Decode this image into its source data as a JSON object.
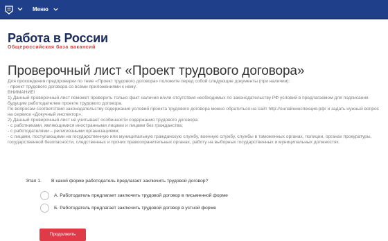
{
  "header": {
    "menu_label": "Меню",
    "logo_icon": "rabota-emblem-icon",
    "chevron_icon": "chevron-down-icon",
    "background": "#1f3f8a"
  },
  "brand": {
    "name": "Работа в России",
    "subtitle": "Общероссийская база вакансий",
    "name_color": "#1a2b5f",
    "subtitle_color": "#d83a3a"
  },
  "page": {
    "title": "Проверочный лист «Проект трудового договора»"
  },
  "info": {
    "lines": [
      "Для прохождения предпроверки по теме «Проект трудового договора» положите перед собой следующие документы (при наличии):",
      "- проект трудового договора со всеми приложениями к нему.",
      "ВНИМАНИЕ!",
      "1) Данный проверочный лист поможет проверить только факт наличия и/или отсутствия необходимых по законодательству РФ условий в предлагаемом для подписания будущим работодателем проекте трудового договора.",
      "По вопросам соответствия законодательству содержания условий проекта трудового договора можно обратиться на сайт http://онлайнинспекция.рф/ и задать нужный вопрос на сервисе «Докучный инспектор».",
      "2) Данный проверочный лист не учитывает особенности содержания трудового договора:",
      "- с работниками, являющимися иностранными лицами и лицами без гражданства;",
      "- с работодателями – религиозными организациями;",
      "- с лицами, поступающими на государственную или муниципальную гражданскую службу, военную службу, службы в таможенных органах, полиции, органах прокуратуры, государственной безопасности, следственных и прочих правоохранительных органах, работу на выборных государственных и муниципальных должностях."
    ]
  },
  "quiz": {
    "stage": "Этап 1.",
    "question": "В какой форме работодатель предлагает заключить трудовой договор?",
    "options": [
      "А. Работодатель предлагает заключить трудовой договор в письменной форме",
      "Б. Работодатель предлагает заключить трудовой договор в устной форме"
    ],
    "continue_label": "Продолжить",
    "button_color": "#e03a48"
  }
}
